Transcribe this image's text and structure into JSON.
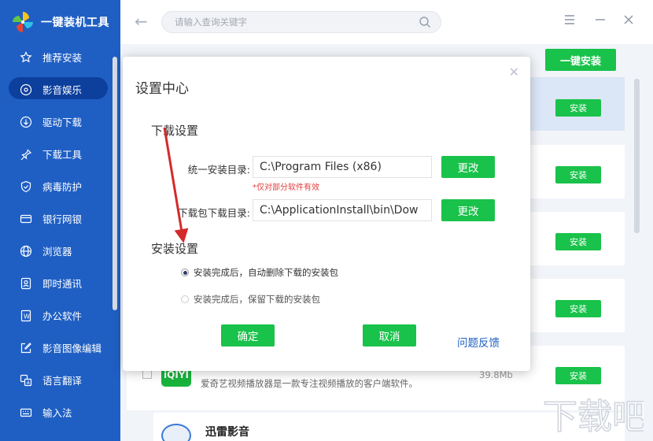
{
  "app": {
    "title": "一键装机工具"
  },
  "sidebar": {
    "items": [
      {
        "label": "推荐安装",
        "icon": "star-icon"
      },
      {
        "label": "影音娱乐",
        "icon": "disc-icon",
        "active": true
      },
      {
        "label": "驱动下载",
        "icon": "download-circle-icon"
      },
      {
        "label": "下载工具",
        "icon": "pin-icon"
      },
      {
        "label": "病毒防护",
        "icon": "shield-icon"
      },
      {
        "label": "银行网银",
        "icon": "card-icon"
      },
      {
        "label": "浏览器",
        "icon": "globe-icon"
      },
      {
        "label": "即时通讯",
        "icon": "contact-icon"
      },
      {
        "label": "办公软件",
        "icon": "word-icon"
      },
      {
        "label": "影音图像编辑",
        "icon": "edit-icon"
      },
      {
        "label": "语言翻译",
        "icon": "translate-icon"
      },
      {
        "label": "输入法",
        "icon": "keyboard-icon"
      }
    ]
  },
  "topbar": {
    "search_placeholder": "请输入查询关键字",
    "back_icon": "back-arrow-icon",
    "search_icon": "search-icon"
  },
  "content": {
    "one_key_install": "一键安装",
    "install_label": "安装",
    "iqiyi": {
      "logo": "iQIYI",
      "desc": "爱奇艺视频播放器是一款专注视频播放的客户端软件。",
      "size": "39.8Mb"
    },
    "next_row_name": "迅雷影音"
  },
  "dialog": {
    "title": "设置中心",
    "download_section": "下载设置",
    "install_dir_label": "统一安装目录:",
    "install_dir_value": "C:\\Program Files (x86)",
    "change_label": "更改",
    "note": "*仅对部分软件有效",
    "pkg_dir_label": "下载包下载目录:",
    "pkg_dir_value": "C:\\ApplicationInstall\\bin\\Dow",
    "install_section": "安装设置",
    "option_delete": "安装完成后，自动删除下载的安装包",
    "option_keep": "安装完成后，保留下载的安装包",
    "confirm": "确定",
    "cancel": "取消",
    "feedback": "问题反馈"
  },
  "colors": {
    "sidebar": "#1f5fc4",
    "green": "#19c24a",
    "arrow": "#d42a2a"
  },
  "watermark": {
    "logo_text": "下载吧"
  }
}
